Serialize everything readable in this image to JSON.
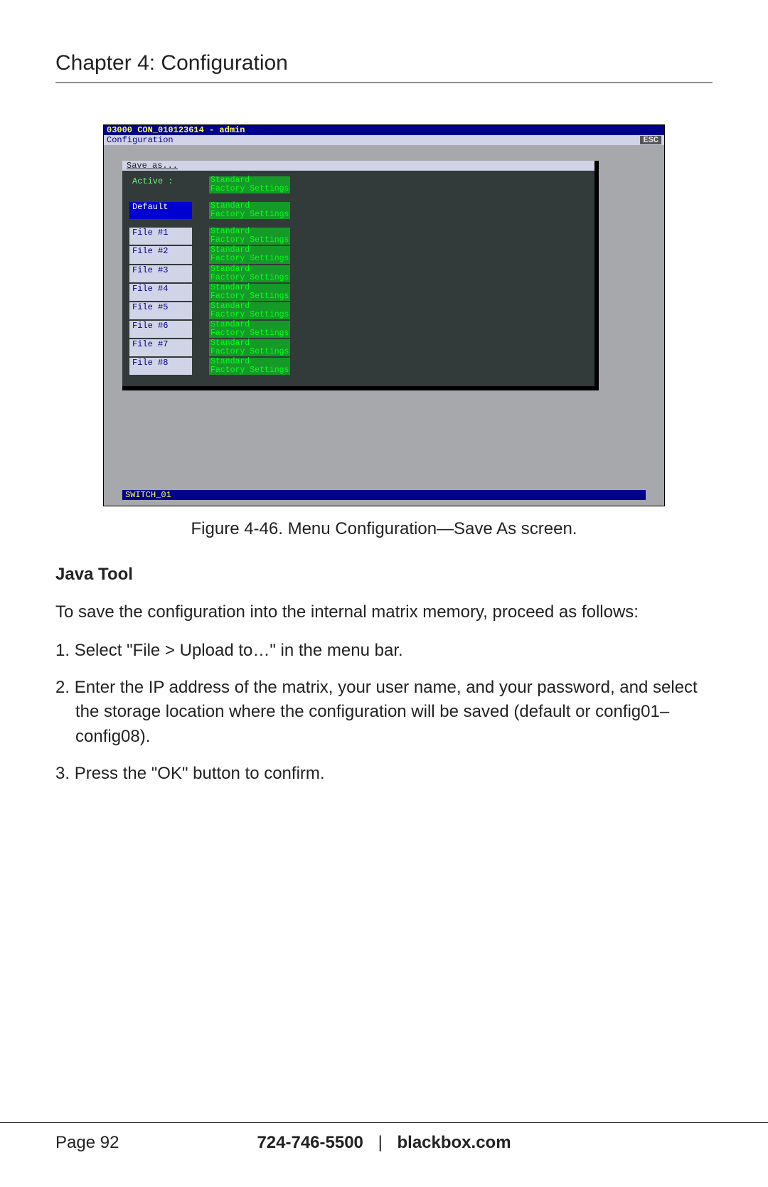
{
  "chapter": "Chapter 4: Configuration",
  "screenshot": {
    "titlebar": "03000 CON_010123614 - admin",
    "menubar": {
      "items": [
        "Configuration"
      ],
      "esc": "ESC"
    },
    "panel_title": "Save as...",
    "active_label": "Active :",
    "value_std": "Standard",
    "value_fac": "Factory Settings",
    "slots": [
      {
        "label": "Default",
        "selected": true
      },
      {
        "label": "File #1",
        "selected": false
      },
      {
        "label": "File #2",
        "selected": false
      },
      {
        "label": "File #3",
        "selected": false
      },
      {
        "label": "File #4",
        "selected": false
      },
      {
        "label": "File #5",
        "selected": false
      },
      {
        "label": "File #6",
        "selected": false
      },
      {
        "label": "File #7",
        "selected": false
      },
      {
        "label": "File #8",
        "selected": false
      }
    ],
    "statusbar": "SWITCH_01"
  },
  "caption": "Figure 4-46. Menu Configuration—Save As screen.",
  "java_tool_heading": "Java Tool",
  "intro": "To save the configuration into the internal matrix memory, proceed as follows:",
  "steps": [
    "Select \"File > Upload to…\" in the menu bar.",
    "Enter the IP address of the matrix, your user name, and your password, and select the storage location where the configuration will be saved (default or config01–config08).",
    "Press the \"OK\" button to confirm."
  ],
  "footer": {
    "page": "Page 92",
    "phone": "724-746-5500",
    "site": "blackbox.com",
    "sep": "|"
  }
}
